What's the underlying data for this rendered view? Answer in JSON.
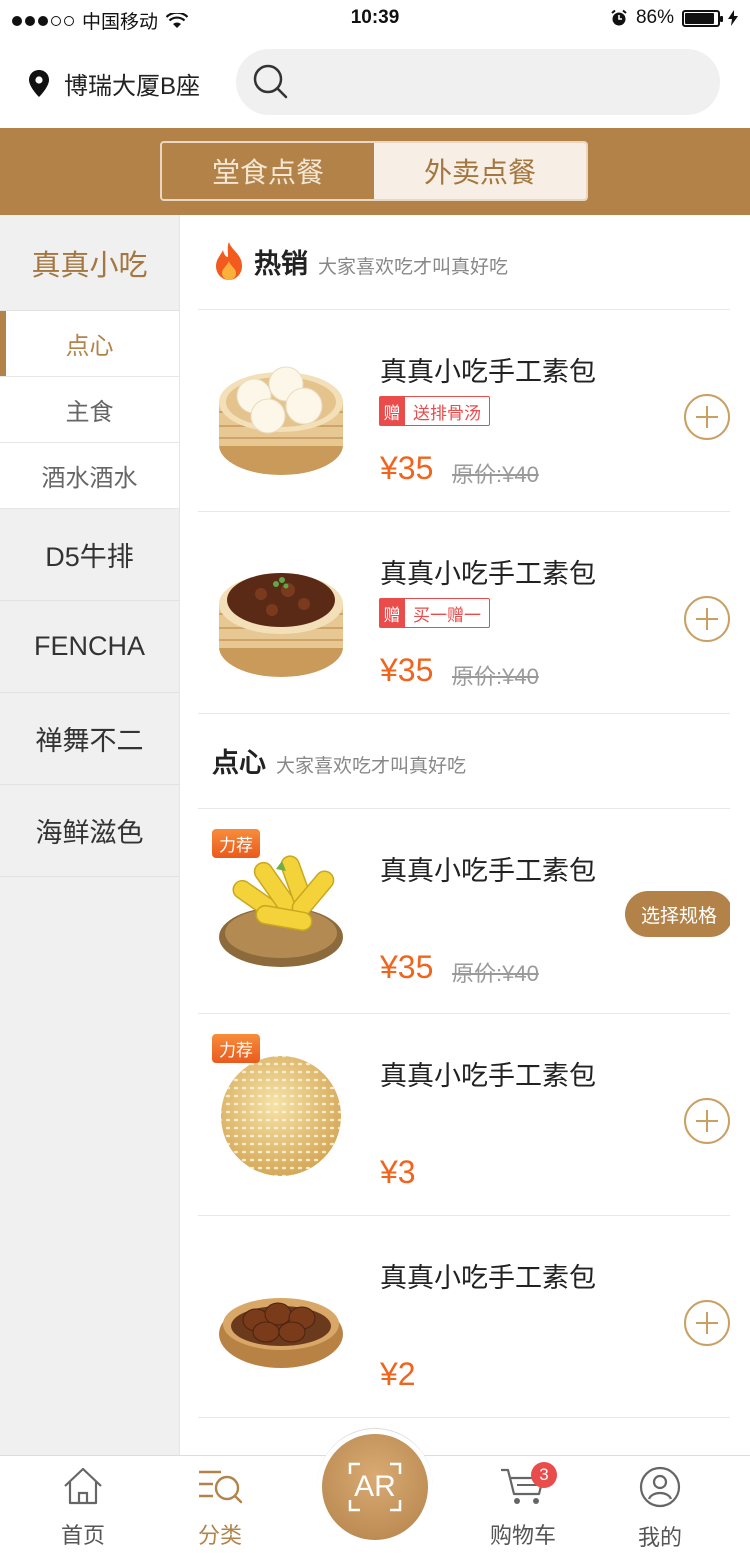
{
  "status_bar": {
    "carrier": "中国移动",
    "time": "10:39",
    "battery": "86%",
    "battery_level": 0.86
  },
  "header": {
    "location": "博瑞大厦B座",
    "search_placeholder": ""
  },
  "tabs": [
    {
      "label": "堂食点餐",
      "active": false
    },
    {
      "label": "外卖点餐",
      "active": true
    }
  ],
  "sidebar": {
    "top": "真真小吃",
    "sub_items": [
      {
        "label": "点心",
        "active": true
      },
      {
        "label": "主食",
        "active": false
      },
      {
        "label": "酒水酒水",
        "active": false
      }
    ],
    "items": [
      "D5牛排",
      "FENCHA",
      "禅舞不二",
      "海鲜滋色"
    ]
  },
  "sections": [
    {
      "title": "热销",
      "subtitle": "大家喜欢吃才叫真好吃",
      "items": [
        {
          "name": "真真小吃手工素包",
          "gift_tag": "赠",
          "gift_text": "送排骨汤",
          "price": "¥35",
          "orig": "原价:¥40",
          "image": "steamed-buns"
        },
        {
          "name": "真真小吃手工素包",
          "gift_tag": "赠",
          "gift_text": "买一赠一",
          "price": "¥35",
          "orig": "原价:¥40",
          "image": "steamed-beef"
        }
      ]
    },
    {
      "title": "点心",
      "subtitle": "大家喜欢吃才叫真好吃",
      "items": [
        {
          "name": "真真小吃手工素包",
          "badge": "力荐",
          "price": "¥35",
          "orig": "原价:¥40",
          "action": "选择规格",
          "image": "corn"
        },
        {
          "name": "真真小吃手工素包",
          "badge": "力荐",
          "price": "¥3",
          "image": "sesame-ball"
        },
        {
          "name": "真真小吃手工素包",
          "price": "¥2",
          "image": "tea-eggs"
        }
      ]
    }
  ],
  "bottom_nav": {
    "home": "首页",
    "category": "分类",
    "ar": "AR",
    "cart": "购物车",
    "cart_count": "3",
    "mine": "我的"
  },
  "colors": {
    "brand": "#b28249",
    "price": "#f0641e",
    "gift": "#ea4b4b"
  }
}
